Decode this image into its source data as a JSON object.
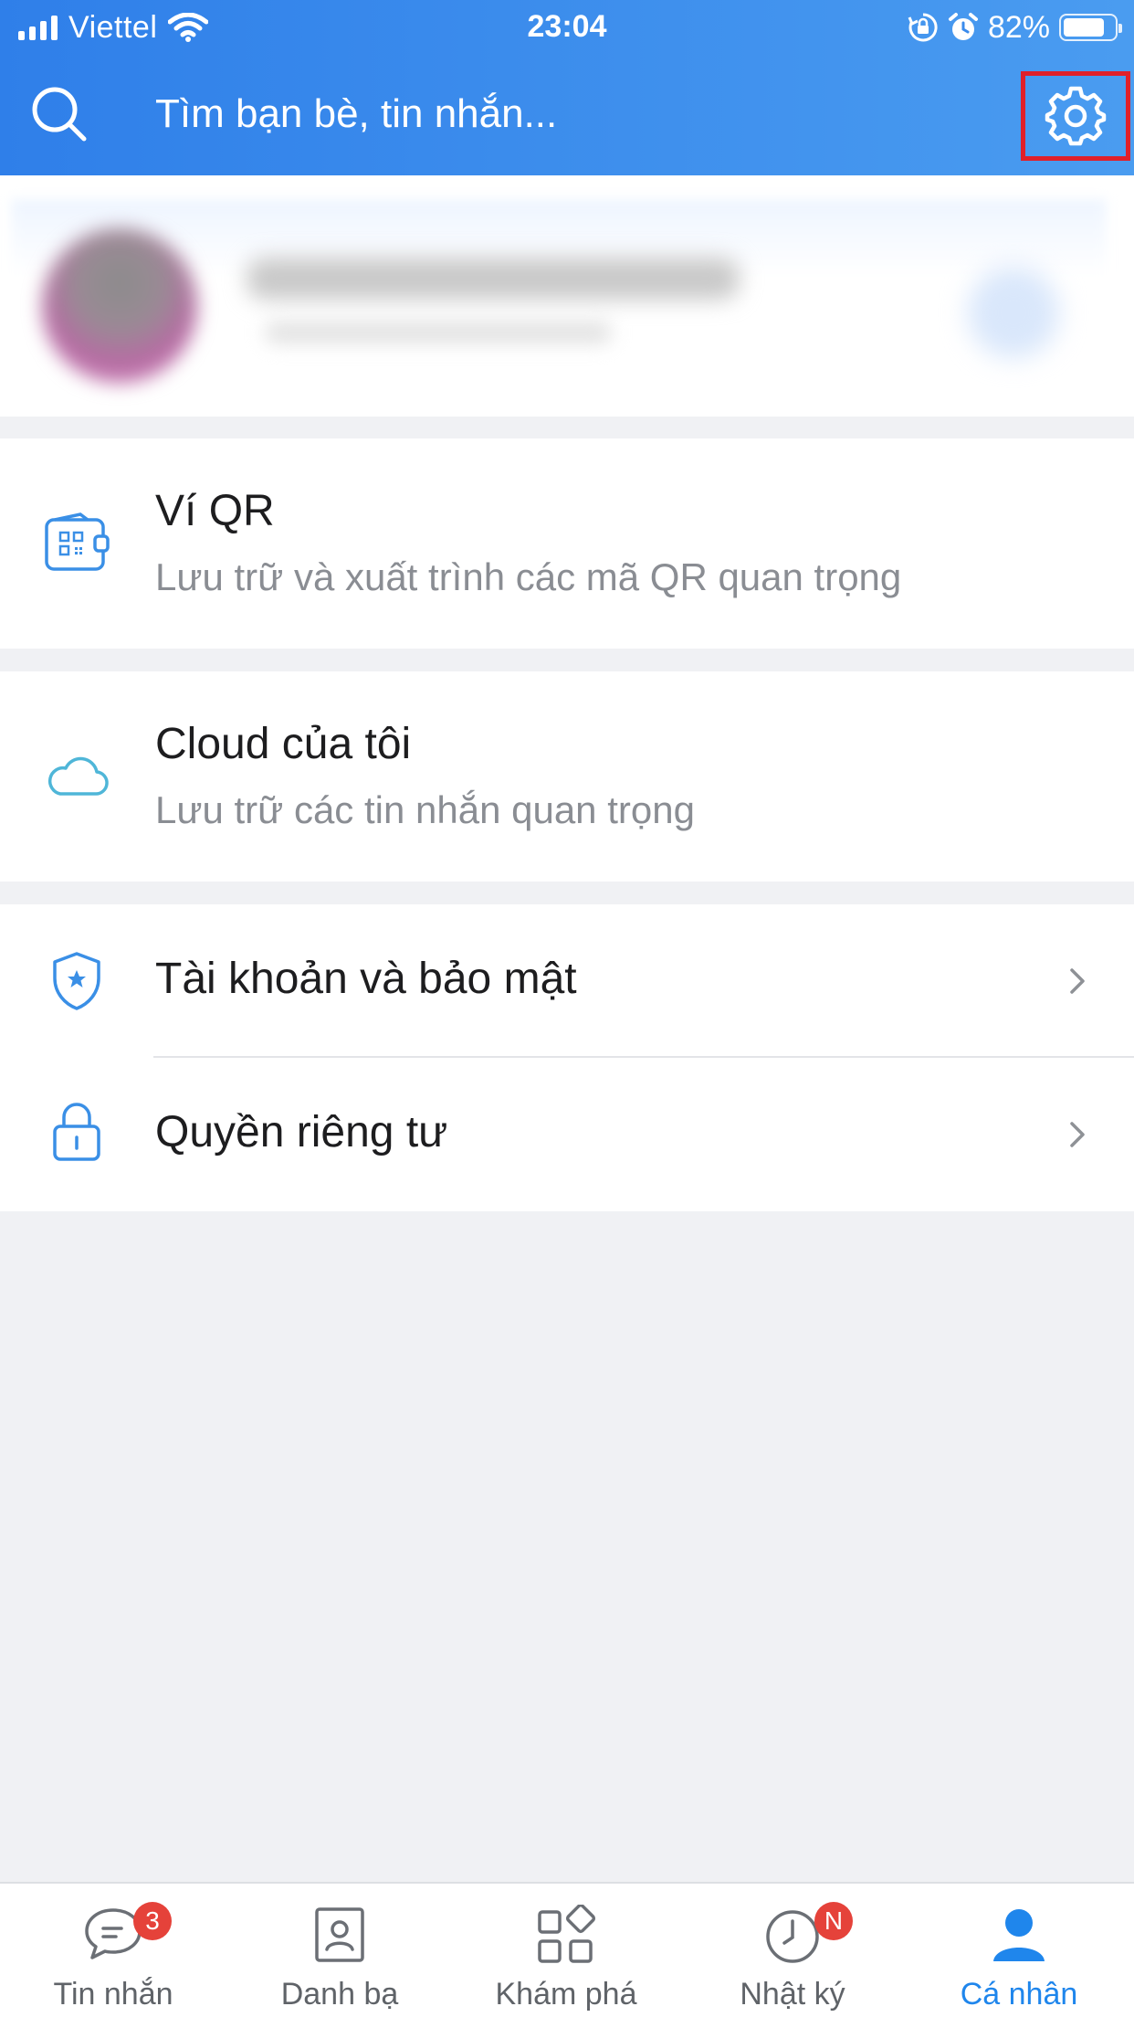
{
  "status_bar": {
    "carrier": "Viettel",
    "time": "23:04",
    "battery_percent": "82%",
    "battery_level": 0.82
  },
  "search": {
    "placeholder": "Tìm bạn bè, tin nhắn..."
  },
  "menu": {
    "qr_wallet": {
      "title": "Ví QR",
      "subtitle": "Lưu trữ và xuất trình các mã QR quan trọng",
      "icon": "qr-wallet-icon"
    },
    "cloud": {
      "title": "Cloud của tôi",
      "subtitle": "Lưu trữ các tin nhắn quan trọng",
      "icon": "cloud-icon"
    },
    "account_security": {
      "title": "Tài khoản và bảo mật",
      "icon": "shield-icon"
    },
    "privacy": {
      "title": "Quyền riêng tư",
      "icon": "lock-icon"
    }
  },
  "tabs": [
    {
      "label": "Tin nhắn",
      "badge": "3",
      "icon": "chat-icon"
    },
    {
      "label": "Danh bạ",
      "icon": "contacts-icon"
    },
    {
      "label": "Khám phá",
      "icon": "discover-icon"
    },
    {
      "label": "Nhật ký",
      "badge": "N",
      "icon": "clock-icon"
    },
    {
      "label": "Cá nhân",
      "icon": "person-icon",
      "active": true
    }
  ],
  "colors": {
    "header_start": "#2f7fe9",
    "header_end": "#4a9cf0",
    "accent": "#1f86ec",
    "badge": "#e5423a",
    "highlight_box": "#e0202a"
  }
}
